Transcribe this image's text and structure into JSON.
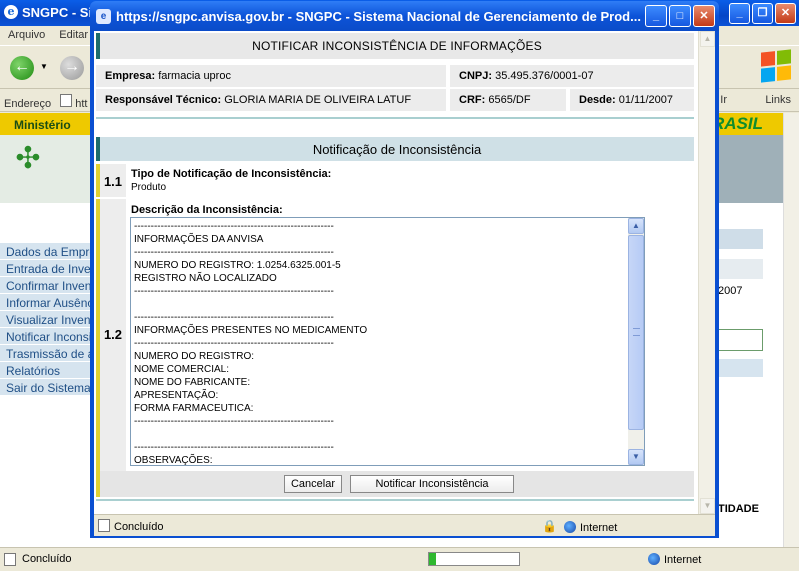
{
  "background_browser": {
    "title": "SNGPC - Si",
    "menu": [
      "Arquivo",
      "Editar"
    ],
    "address_label": "Endereço",
    "address_value": "htt",
    "ir_label": "Ir",
    "links_label": "Links",
    "ministerio": "Ministério",
    "brasil": "BRASIL",
    "sidebar_items": [
      "Dados da Empresa",
      "Entrada de Inventário",
      "Confirmar Inventário",
      "Informar Ausência",
      "Visualizar Inventário",
      "Notificar Inconsistência",
      "Trasmissão de arquivos",
      "Relatórios",
      "Sair do Sistema"
    ],
    "right_year": "2007",
    "right_column_header": "TIDADE",
    "status": "Concluído",
    "zone": "Internet",
    "progress_fraction": 0.08
  },
  "popup": {
    "title": "https://sngpc.anvisa.gov.br - SNGPC - Sistema Nacional de Gerenciamento de Prod...",
    "status": "Concluído",
    "zone": "Internet"
  },
  "form": {
    "header": "NOTIFICAR INCONSISTÊNCIA DE INFORMAÇÕES",
    "empresa_label": "Empresa:",
    "empresa_value": "farmacia uproc",
    "cnpj_label": "CNPJ:",
    "cnpj_value": "35.495.376/0001-07",
    "responsavel_label": "Responsável Técnico:",
    "responsavel_value": "GLORIA MARIA DE OLIVEIRA LATUF",
    "crf_label": "CRF:",
    "crf_value": "6565/DF",
    "desde_label": "Desde:",
    "desde_value": "01/11/2007",
    "section_title": "Notificação de Inconsistência",
    "item1_number": "1.1",
    "item1_label": "Tipo de Notificação de Inconsistência:",
    "item1_value": "Produto",
    "item2_number": "1.2",
    "item2_label": "Descrição da Inconsistência:",
    "description_lines": [
      "------------------------------------------------------------",
      "INFORMAÇÕES DA ANVISA",
      "------------------------------------------------------------",
      "NUMERO DO REGISTRO: 1.0254.6325.001-5",
      "REGISTRO NÃO LOCALIZADO",
      "------------------------------------------------------------",
      "",
      "------------------------------------------------------------",
      "INFORMAÇÕES PRESENTES NO MEDICAMENTO",
      "------------------------------------------------------------",
      "NUMERO DO REGISTRO:",
      "NOME COMERCIAL:",
      "NOME DO FABRICANTE:",
      "APRESENTAÇÃO:",
      "FORMA FARMACEUTICA:",
      "------------------------------------------------------------",
      "",
      "------------------------------------------------------------",
      "OBSERVAÇÕES:"
    ],
    "cancel_label": "Cancelar",
    "notify_label": "Notificar Inconsistência"
  }
}
